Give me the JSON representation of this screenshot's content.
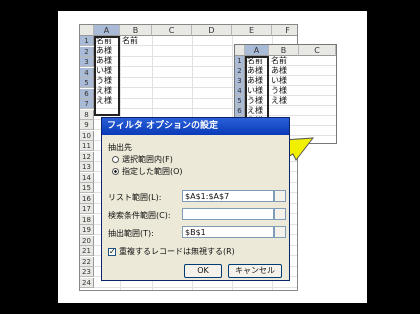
{
  "spreadsheet": {
    "columns": [
      "A",
      "B",
      "C",
      "D",
      "E",
      "F"
    ],
    "rows": [
      "1",
      "2",
      "3",
      "4",
      "5",
      "6",
      "7",
      "8",
      "9",
      "10",
      "11",
      "12",
      "13",
      "14",
      "15",
      "16",
      "17",
      "18",
      "19",
      "20",
      "21",
      "22",
      "23",
      "24"
    ],
    "a_cells": [
      "名前",
      "あ様",
      "あ様",
      "い様",
      "う様",
      "え様",
      "え様"
    ],
    "b1": "名前"
  },
  "inset": {
    "columns": [
      "A",
      "B",
      "C"
    ],
    "rows": [
      "1",
      "2",
      "3",
      "4",
      "5",
      "6",
      "7",
      "8"
    ],
    "a_cells": [
      "名前",
      "あ様",
      "あ様",
      "い様",
      "う様",
      "え様",
      "え様"
    ],
    "b_cells": [
      "名前",
      "あ様",
      "い様",
      "う様",
      "え様"
    ]
  },
  "dialog": {
    "title": "フィルタ オプションの設定",
    "group_label": "抽出先",
    "radio_in_place": "選択範囲内(F)",
    "radio_copy": "指定した範囲(O)",
    "list_range_label": "リスト範囲(L):",
    "list_range_value": "$A$1:$A$7",
    "criteria_label": "検索条件範囲(C):",
    "criteria_value": "",
    "copy_to_label": "抽出範囲(T):",
    "copy_to_value": "$B$1",
    "unique_checkbox": "重複するレコードは無視する(R)",
    "unique_checked": true,
    "ok_label": "OK",
    "cancel_label": "キャンセル"
  },
  "colors": {
    "titlebar": "#0a3ab8",
    "arrow": "#f0f000",
    "selected_header": "#aabbd8"
  }
}
